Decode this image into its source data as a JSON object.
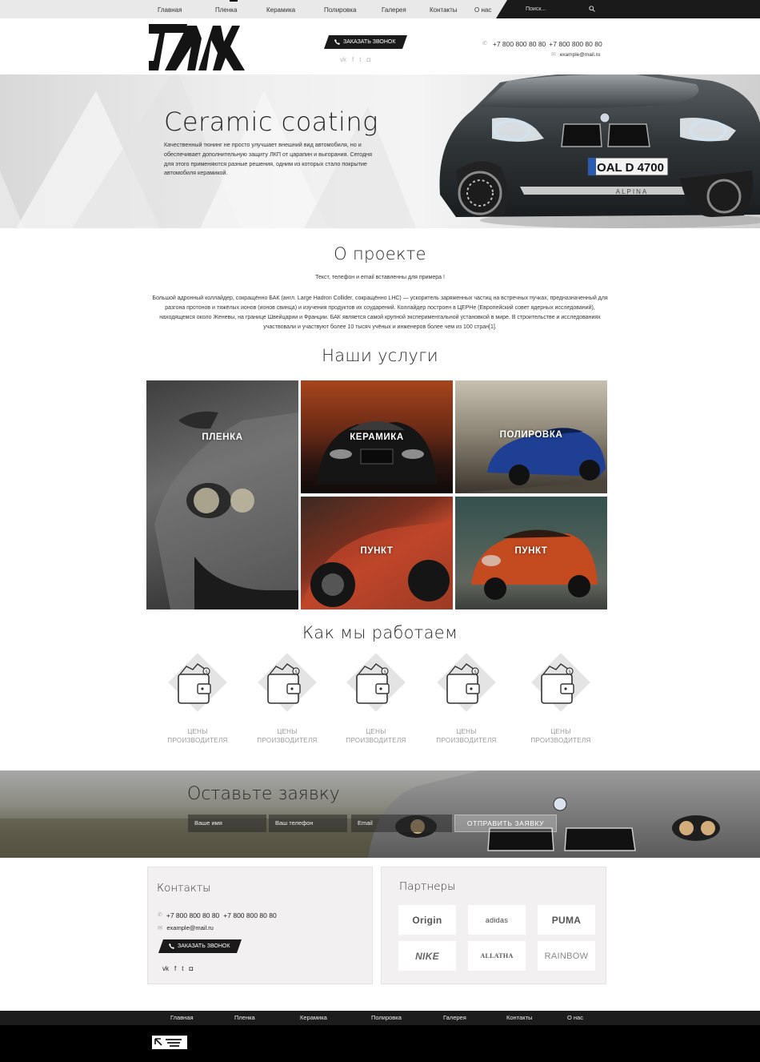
{
  "nav": {
    "items": [
      "Главная",
      "Пленка",
      "Керамика",
      "Полировка",
      "Галерея",
      "Контакты",
      "О нас"
    ],
    "active_index": 1,
    "search_placeholder": "Поиск..."
  },
  "header": {
    "callback_label": "ЗАКАЗАТЬ ЗВОНОК",
    "phone1": "+7 800 800 80 80",
    "phone2": "+7 800 800 80 80",
    "email": "example@mail.ru",
    "social_icons": [
      "vk-icon",
      "facebook-icon",
      "twitter-icon",
      "instagram-icon"
    ]
  },
  "hero": {
    "title": "Ceramic coating",
    "text": "Качественный тюнинг не просто улучшает внешний вид автомобиля, но и обеспечивает дополнительную защиту ЛКП от царапин и выгорания. Сегодня для этого применяются разные решения, одним из которых стало покрытие автомобиля керамикой.",
    "plate": "OAL D 4700",
    "badge_text": "ALPINA"
  },
  "about": {
    "title": "О проекте",
    "subtitle": "Текст, телефон и email вставленны для примера !",
    "text": "Большой адронный коллайдер, сокращённо БАК (англ. Large Hadron Collider, сокращённо LHC) — ускоритель заряженных частиц на встречных пучках, предназначенный для разгона протонов и тяжёлых ионов (ионов свинца) и изучения продуктов их соударений. Коллайдер построен в ЦЕРНе (Европейский совет ядерных исследований), находящемся около Женевы, на границе Швейцарии и Франции. БАК является самой крупной экспериментальной установкой в мире. В строительстве и исследованиях участвовали и участвуют более 10 тысяч учёных и инженеров более чем из 100 стран[1]."
  },
  "services": {
    "title": "Наши услуги",
    "tiles": [
      "ПЛЕНКА",
      "КЕРАМИКА",
      "ПОЛИРОВКА",
      "ПУНКТ",
      "ПУНКТ"
    ]
  },
  "how": {
    "title": "Как мы работаем",
    "steps": [
      {
        "line1": "ЦЕНЫ",
        "line2": "ПРОИЗВОДИТЕЛЯ"
      },
      {
        "line1": "ЦЕНЫ",
        "line2": "ПРОИЗВОДИТЕЛЯ"
      },
      {
        "line1": "ЦЕНЫ",
        "line2": "ПРОИЗВОДИТЕЛЯ"
      },
      {
        "line1": "ЦЕНЫ",
        "line2": "ПРОИЗВОДИТЕЛЯ"
      },
      {
        "line1": "ЦЕНЫ",
        "line2": "ПРОИЗВОДИТЕЛЯ"
      }
    ],
    "icon": "wallet-icon"
  },
  "request": {
    "title": "Оставьте заявку",
    "name_placeholder": "Ваше имя",
    "phone_placeholder": "Ваш телефон",
    "email_placeholder": "Email",
    "submit_label": "ОТПРАВИТЬ ЗАЯВКУ"
  },
  "contacts": {
    "title": "Контакты",
    "phone1": "+7 800 800 80 80",
    "phone2": "+7 800 800 80 80",
    "email": "example@mail.ru",
    "callback_label": "ЗАКАЗАТЬ ЗВОНОК"
  },
  "partners": {
    "title": "Партнеры",
    "logos": [
      "Origin",
      "adidas",
      "PUMA",
      "NIKE",
      "ALLATHA",
      "RAINBOW"
    ]
  },
  "footer": {
    "items": [
      "Главная",
      "Пленка",
      "Керамика",
      "Полировка",
      "Галерея",
      "Контакты",
      "О нас"
    ]
  },
  "colors": {
    "dark": "#1a1a1a",
    "light_bg": "#f2f0f0",
    "muted_text": "#999999"
  }
}
